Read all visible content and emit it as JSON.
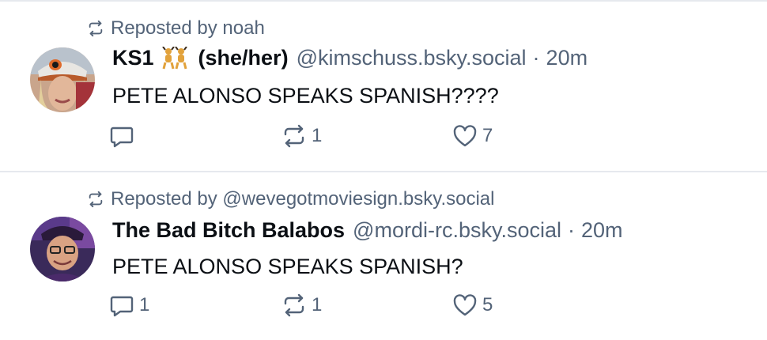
{
  "colors": {
    "text": "#0b0f14",
    "muted": "#536378",
    "divider": "#e6e9ee"
  },
  "posts": [
    {
      "repost_label": "Reposted by noah",
      "display_name": "KS1",
      "name_suffix": "(she/her)",
      "name_emoji": "dancers-emoji",
      "handle": "@kimschuss.bsky.social",
      "separator": "·",
      "time": "20m",
      "text": "PETE ALONSO SPEAKS SPANISH????",
      "reply_count": "",
      "repost_count": "1",
      "like_count": "7"
    },
    {
      "repost_label": "Reposted by @wevegotmoviesign.bsky.social",
      "display_name": "The Bad Bitch Balabos",
      "handle": "@mordi-rc.bsky.social",
      "separator": "·",
      "time": "20m",
      "text": "PETE ALONSO SPEAKS SPANISH?",
      "reply_count": "1",
      "repost_count": "1",
      "like_count": "5"
    }
  ]
}
